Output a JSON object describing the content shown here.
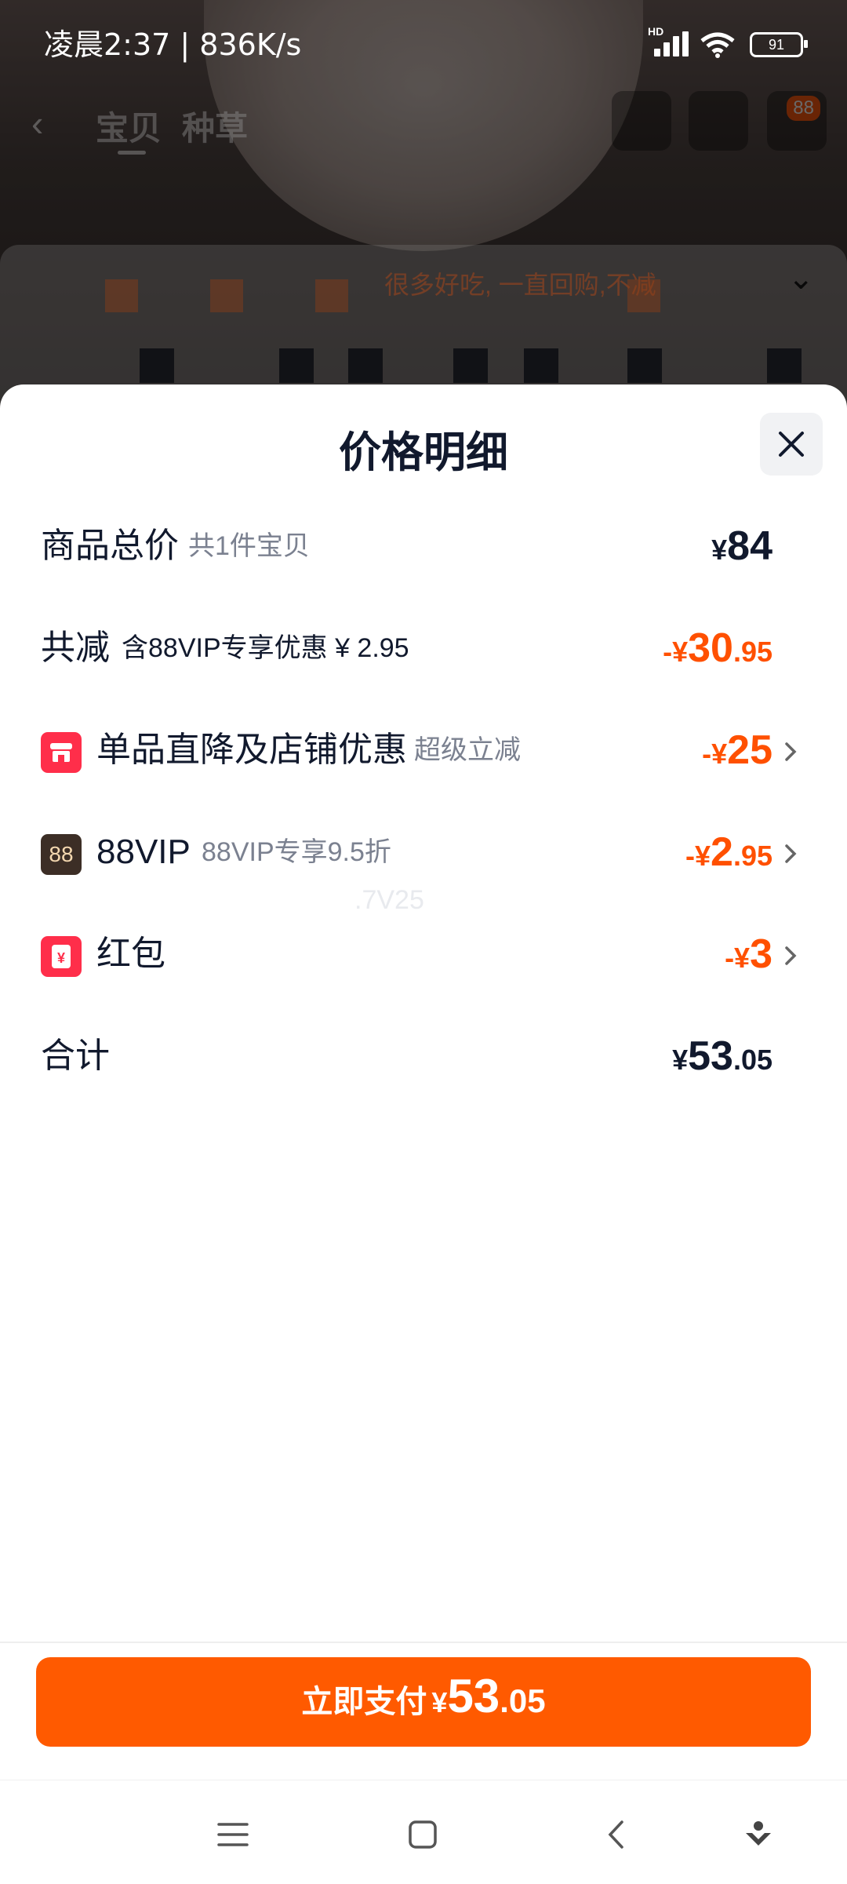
{
  "status_bar": {
    "time_speed": "凌晨2:37 | 836K/s",
    "network": "HD",
    "battery": "91"
  },
  "background": {
    "tabs": [
      "宝贝",
      "种草"
    ],
    "cart_badge": "88",
    "card_text": "很多好吃, 一直回购,不减"
  },
  "sheet": {
    "title": "价格明细",
    "rows": {
      "total": {
        "label": "商品总价",
        "sub": "共1件宝贝",
        "currency": "¥",
        "int": "84",
        "dec": ""
      },
      "reduce": {
        "label": "共减",
        "sub": "含88VIP专享优惠 ¥ 2.95",
        "currency": "-¥",
        "int": "30",
        "dec": ".95"
      },
      "direct": {
        "label": "单品直降及店铺优惠",
        "sub": "超级立减",
        "currency": "-¥",
        "int": "25",
        "dec": "",
        "icon": "store-icon"
      },
      "vip": {
        "label": "88VIP",
        "sub": "88VIP专享9.5折",
        "currency": "-¥",
        "int": "2",
        "dec": ".95",
        "icon_text": "88"
      },
      "redpacket": {
        "label": "红包",
        "sub": "",
        "currency": "-¥",
        "int": "3",
        "dec": "",
        "icon": "red-packet-icon"
      },
      "sum": {
        "label": "合计",
        "currency": "¥",
        "int": "53",
        "dec": ".05"
      }
    },
    "watermark": ".7V25"
  },
  "pay_button": {
    "label": "立即支付",
    "currency": "¥",
    "int": "53",
    "dec": ".05"
  },
  "colors": {
    "accent": "#ff5000",
    "button": "#ff5a00",
    "text": "#11192d",
    "muted": "#7b8190"
  }
}
